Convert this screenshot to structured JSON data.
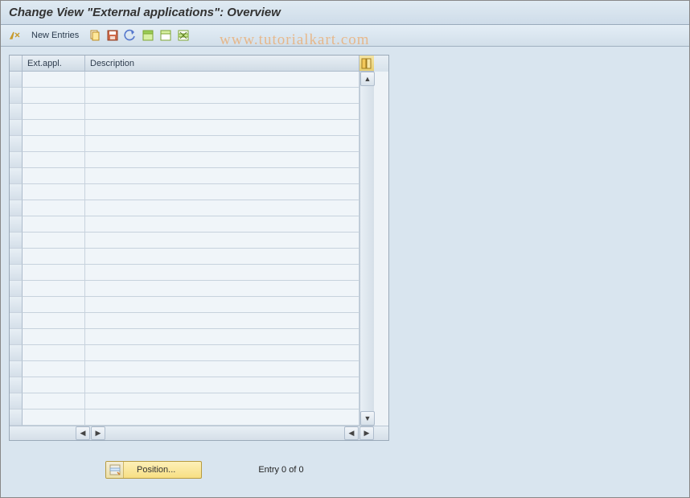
{
  "title": "Change View \"External applications\": Overview",
  "toolbar": {
    "new_entries_label": "New Entries"
  },
  "watermark": "www.tutorialkart.com",
  "grid": {
    "columns": {
      "ext": "Ext.appl.",
      "desc": "Description"
    },
    "row_count": 22
  },
  "footer": {
    "position_label": "Position...",
    "entry_text": "Entry 0 of 0"
  }
}
